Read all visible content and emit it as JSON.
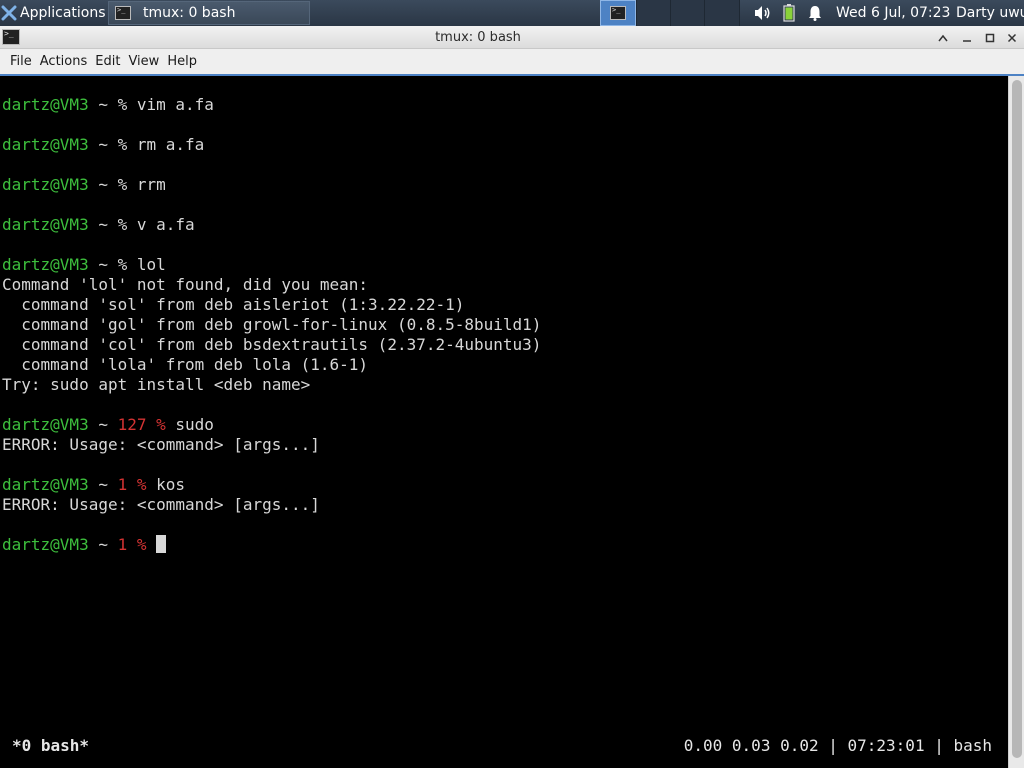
{
  "panel": {
    "applications_label": "Applications",
    "task_label": "tmux: 0 bash",
    "clock": "Wed  6 Jul, 07:23",
    "user": "Darty uwu",
    "icons": [
      "xfce-icon",
      "terminal-icon",
      "volume-icon",
      "battery-icon",
      "notification-bell-icon"
    ]
  },
  "window": {
    "title": "tmux: 0 bash",
    "menu": [
      "File",
      "Actions",
      "Edit",
      "View",
      "Help"
    ]
  },
  "terminal": {
    "prompt_user": "dartz@VM3",
    "lines": [
      {
        "kind": "prompt",
        "tilde": " ~ ",
        "code": "",
        "pct": "% ",
        "cmd": "vim a.fa"
      },
      {
        "kind": "prompt",
        "tilde": " ~ ",
        "code": "",
        "pct": "% ",
        "cmd": "rm a.fa"
      },
      {
        "kind": "prompt",
        "tilde": " ~ ",
        "code": "",
        "pct": "% ",
        "cmd": "rrm"
      },
      {
        "kind": "prompt",
        "tilde": " ~ ",
        "code": "",
        "pct": "% ",
        "cmd": "v a.fa"
      },
      {
        "kind": "prompt",
        "tilde": " ~ ",
        "code": "",
        "pct": "% ",
        "cmd": "lol"
      },
      {
        "kind": "out",
        "text": "Command 'lol' not found, did you mean:"
      },
      {
        "kind": "out",
        "text": "  command 'sol' from deb aisleriot (1:3.22.22-1)"
      },
      {
        "kind": "out",
        "text": "  command 'gol' from deb growl-for-linux (0.8.5-8build1)"
      },
      {
        "kind": "out",
        "text": "  command 'col' from deb bsdextrautils (2.37.2-4ubuntu3)"
      },
      {
        "kind": "out",
        "text": "  command 'lola' from deb lola (1.6-1)"
      },
      {
        "kind": "out",
        "text": "Try: sudo apt install <deb name>"
      },
      {
        "kind": "prompt",
        "tilde": " ~ ",
        "code": "127 ",
        "pct": "% ",
        "cmd": "sudo"
      },
      {
        "kind": "out",
        "text": "ERROR: Usage: <command> [args...]"
      },
      {
        "kind": "prompt",
        "tilde": " ~ ",
        "code": "1 ",
        "pct": "% ",
        "cmd": "kos"
      },
      {
        "kind": "out",
        "text": "ERROR: Usage: <command> [args...]"
      },
      {
        "kind": "prompt",
        "tilde": " ~ ",
        "code": "1 ",
        "pct": "% ",
        "cmd": ""
      }
    ]
  },
  "tmux": {
    "window_list": "*0 bash*",
    "status_right": "0.00 0.03 0.02 | 07:23:01 | bash"
  }
}
